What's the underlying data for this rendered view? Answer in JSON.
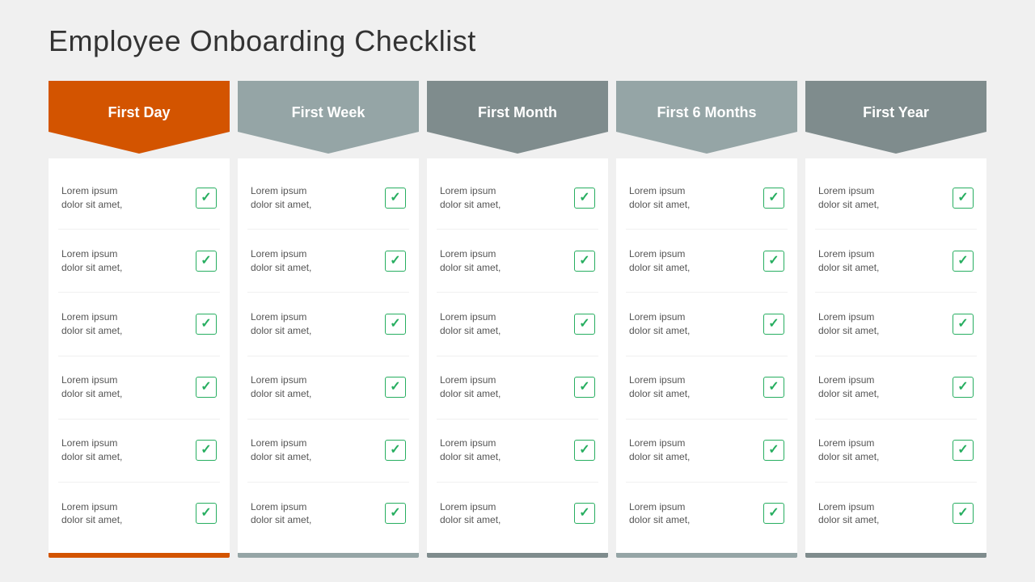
{
  "page": {
    "title": "Employee  Onboarding Checklist"
  },
  "columns": [
    {
      "id": "first-day",
      "label": "First Day",
      "colorClass": "orange",
      "items": [
        {
          "text": "Lorem ipsum\ndolor sit amet,"
        },
        {
          "text": "Lorem ipsum\ndolor sit amet,"
        },
        {
          "text": "Lorem ipsum\ndolor sit amet,"
        },
        {
          "text": "Lorem ipsum\ndolor sit amet,"
        },
        {
          "text": "Lorem ipsum\ndolor sit amet,"
        },
        {
          "text": "Lorem ipsum\ndolor sit amet,"
        }
      ]
    },
    {
      "id": "first-week",
      "label": "First Week",
      "colorClass": "gray1",
      "items": [
        {
          "text": "Lorem ipsum\ndolor sit amet,"
        },
        {
          "text": "Lorem ipsum\ndolor sit amet,"
        },
        {
          "text": "Lorem ipsum\ndolor sit amet,"
        },
        {
          "text": "Lorem ipsum\ndolor sit amet,"
        },
        {
          "text": "Lorem ipsum\ndolor sit amet,"
        },
        {
          "text": "Lorem ipsum\ndolor sit amet,"
        }
      ]
    },
    {
      "id": "first-month",
      "label": "First Month",
      "colorClass": "gray2",
      "items": [
        {
          "text": "Lorem ipsum\ndolor sit amet,"
        },
        {
          "text": "Lorem ipsum\ndolor sit amet,"
        },
        {
          "text": "Lorem ipsum\ndolor sit amet,"
        },
        {
          "text": "Lorem ipsum\ndolor sit amet,"
        },
        {
          "text": "Lorem ipsum\ndolor sit amet,"
        },
        {
          "text": "Lorem ipsum\ndolor sit amet,"
        }
      ]
    },
    {
      "id": "first-6-months",
      "label": "First 6 Months",
      "colorClass": "gray3",
      "items": [
        {
          "text": "Lorem ipsum\ndolor sit amet,"
        },
        {
          "text": "Lorem ipsum\ndolor sit amet,"
        },
        {
          "text": "Lorem ipsum\ndolor sit amet,"
        },
        {
          "text": "Lorem ipsum\ndolor sit amet,"
        },
        {
          "text": "Lorem ipsum\ndolor sit amet,"
        },
        {
          "text": "Lorem ipsum\ndolor sit amet,"
        }
      ]
    },
    {
      "id": "first-year",
      "label": "First Year",
      "colorClass": "gray4",
      "items": [
        {
          "text": "Lorem ipsum\ndolor sit amet,"
        },
        {
          "text": "Lorem ipsum\ndolor sit amet,"
        },
        {
          "text": "Lorem ipsum\ndolor sit amet,"
        },
        {
          "text": "Lorem ipsum\ndolor sit amet,"
        },
        {
          "text": "Lorem ipsum\ndolor sit amet,"
        },
        {
          "text": "Lorem ipsum\ndolor sit amet,"
        }
      ]
    }
  ]
}
